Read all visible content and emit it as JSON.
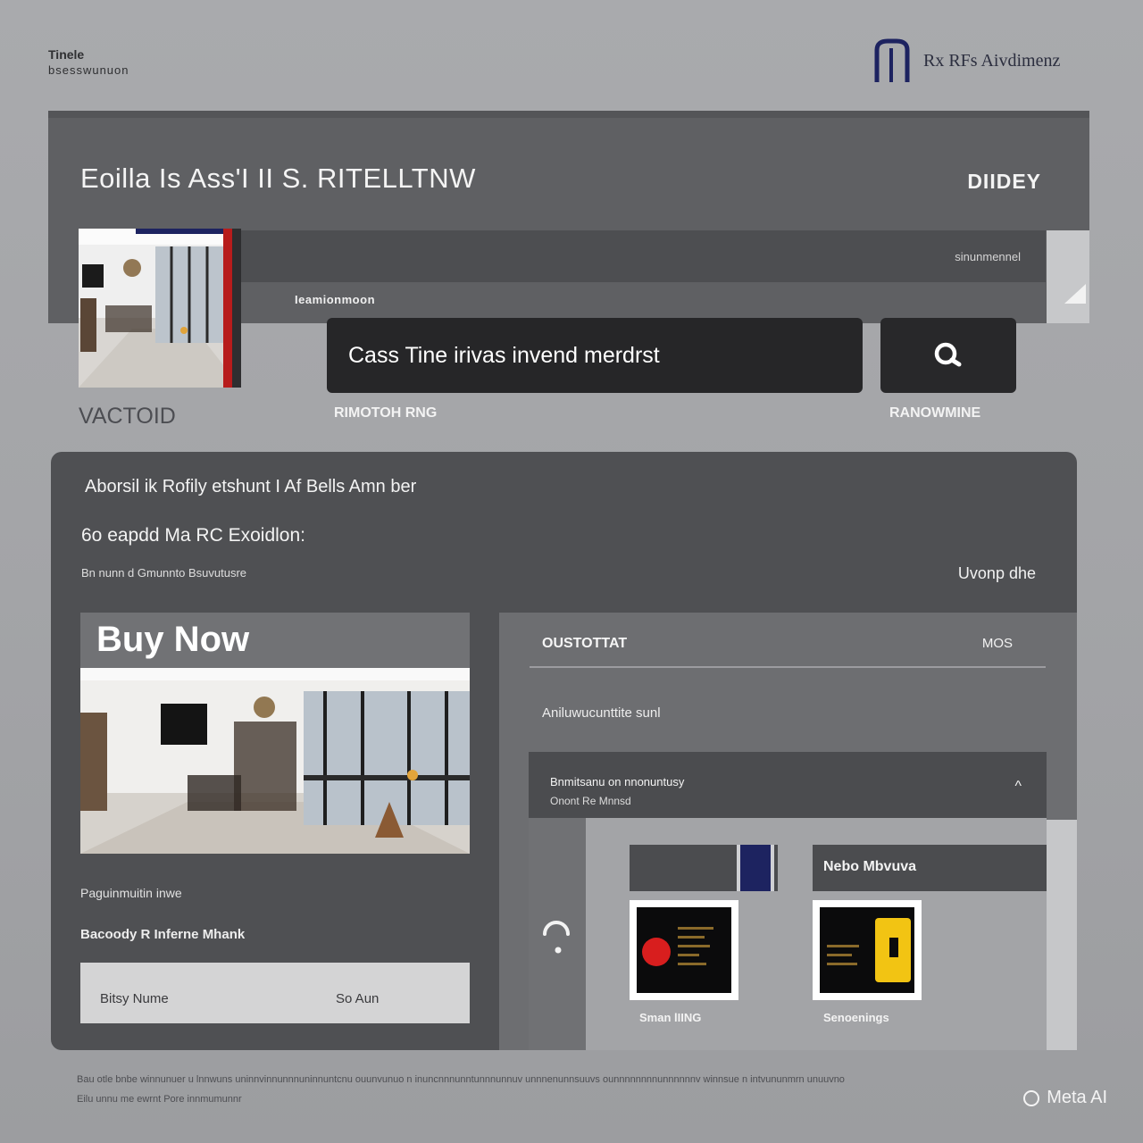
{
  "header": {
    "corner_title": "Tinele",
    "corner_subtitle": "bsesswunuon",
    "brand_name": "Rx RFs Aivdimenz"
  },
  "hero": {
    "title": "Eoilla Is Ass'I II S. RITELLTNW",
    "badge": "DIIDEY",
    "strip_text": "sinunmennel",
    "photo_caption": "VACTOID",
    "search_label": "Ieamionmoon",
    "search_value": "Cass Tine irivas invend merdrst",
    "below_search_label": "RIMOTOH RNG",
    "below_button_label": "RANOWMINE"
  },
  "main": {
    "heading": "Aborsil ik Rofily etshunt I Af Bells Amn ber",
    "subheading": "6o eapdd Ma RC Exoidlon:",
    "small_text": "Bn nunn d Gmunnto Bsuvutusre",
    "right_text": "Uvonp dhe",
    "buy_card": {
      "title": "Buy Now",
      "caption": "Paguinmuitin inwe",
      "caption2": "Bacoody R Inferne Mhank",
      "bar_left": "Bitsy Nume",
      "bar_right": "So Aun"
    },
    "right_panel": {
      "header_left": "OUSTOTTAT",
      "header_right": "MOS",
      "description": "Aniluwucunttite sunl",
      "accordion": {
        "line1": "Bnmitsanu on nnonuntusy",
        "line2": "Onont Re Mnnsd",
        "chevron": "^"
      },
      "tile2_label": "Nebo Mbvuva",
      "thumb1_caption": "Sman lIING",
      "thumb2_caption": "Senoenings"
    }
  },
  "footer": {
    "line1": "Bau otle bnbe winnunuer u lnnwuns uninnvinnunnnuninnuntcnu ouunvunuo n inuncnnnunntunnnunnuv unnnenunnsuuvs ounnnnnnnnunnnnnnv winnsue n intvununmrn unuuvno",
    "line2": "Eilu unnu me ewrnt Pore innmumunnr",
    "watermark": "Meta AI"
  },
  "colors": {
    "page_bg": "#a5a6a9",
    "hero_bg": "#5f6063",
    "panel_bg": "#4f5053",
    "brand_navy": "#1d2360",
    "thumb_red": "#d81e1e",
    "thumb_yellow": "#f2c413"
  },
  "icons": {
    "brand": "arch-logo-icon",
    "search": "search-icon",
    "chevron": "chevron-up-icon",
    "loading": "spinner-icon"
  }
}
